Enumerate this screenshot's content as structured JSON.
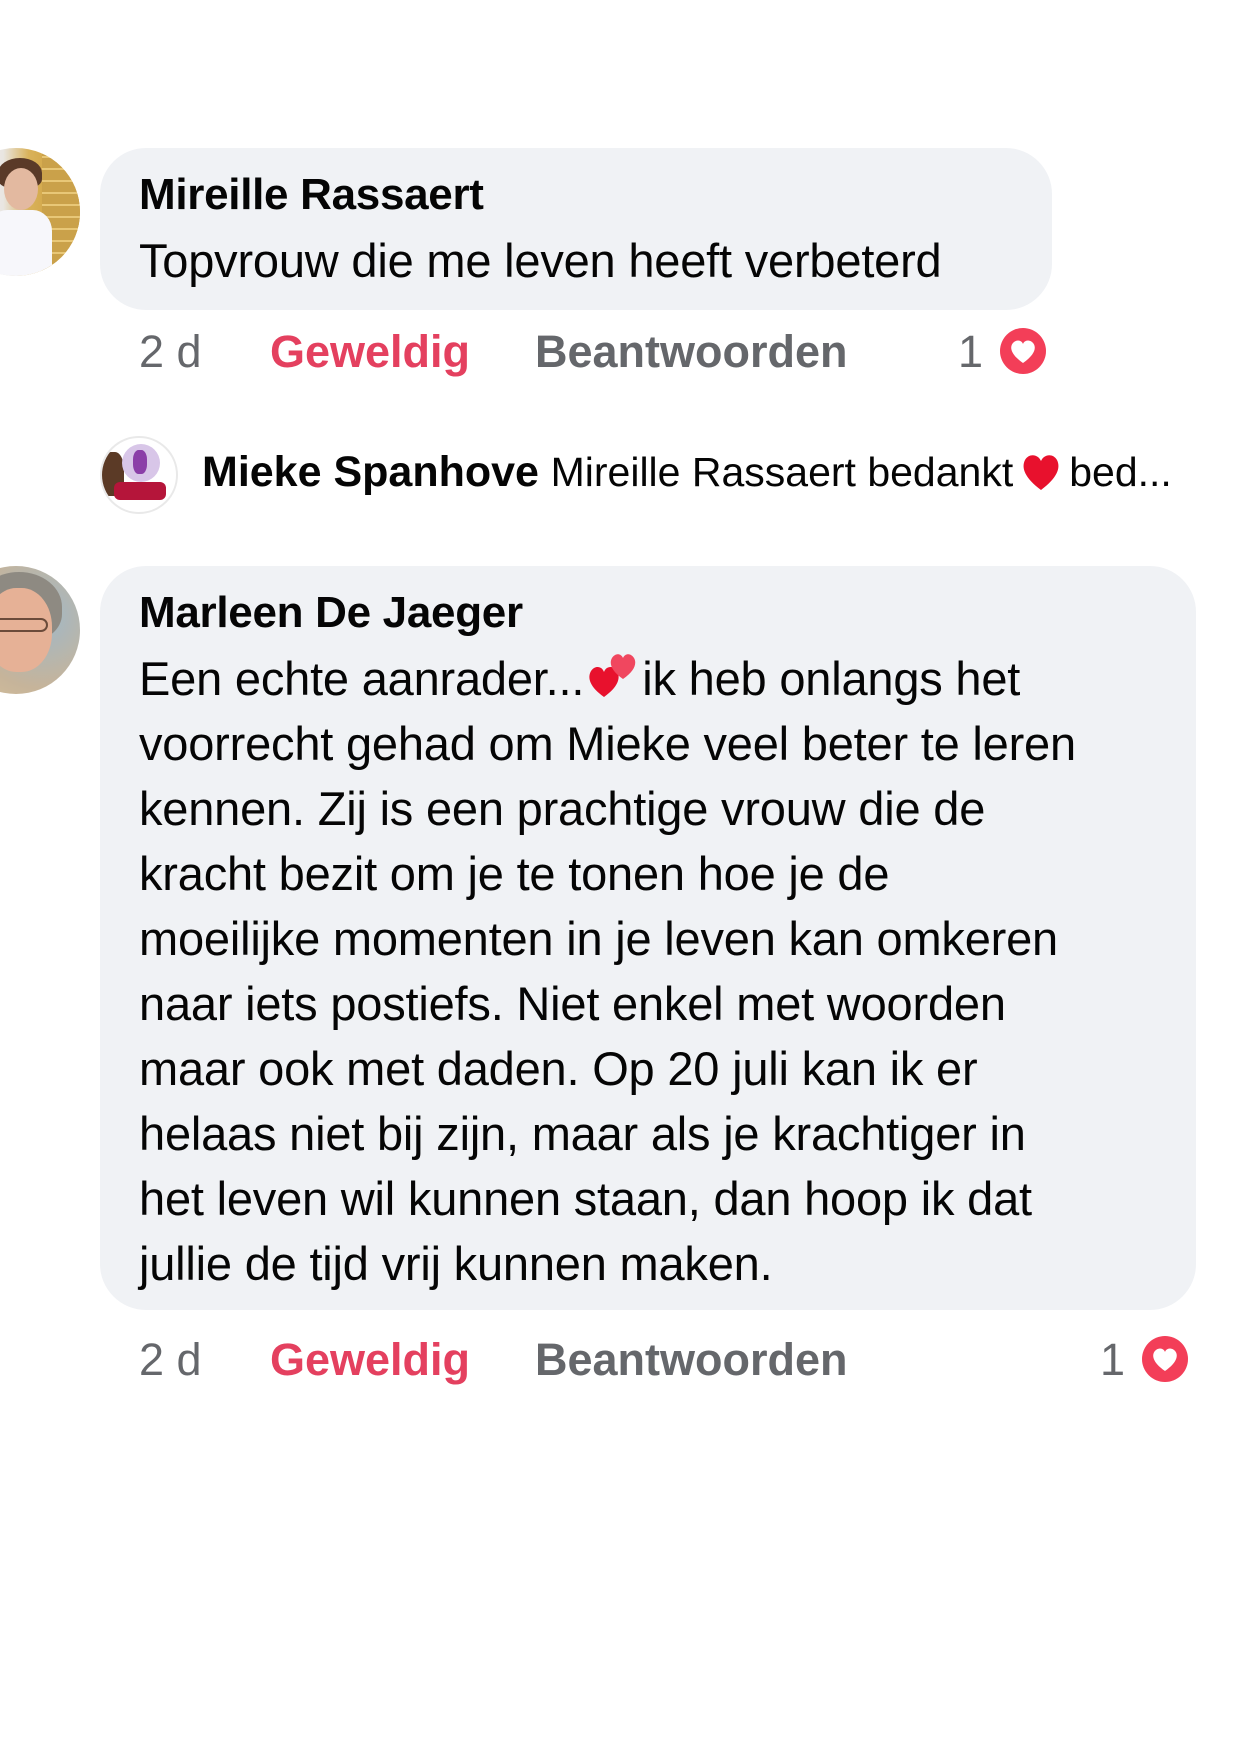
{
  "comments": [
    {
      "author": "Mireille Rassaert",
      "text": "Topvrouw die me leven heeft verbeterd",
      "time": "2 d",
      "like_label": "Geweldig",
      "reply_label": "Beantwoorden",
      "reaction_count": "1",
      "avatar": "profile-photo"
    },
    {
      "author": "Marleen De Jaeger",
      "text_lines": [
        "Een echte aanrader...",
        "ik heb onlangs het",
        "voorrecht gehad om Mieke veel beter te leren",
        "kennen. Zij is een prachtige vrouw die de",
        "kracht bezit om je te tonen hoe je de",
        "moeilijke momenten in je leven kan omkeren",
        "naar iets postiefs. Niet enkel met woorden",
        "maar ook met daden. Op 20 juli kan ik er",
        "helaas niet bij zijn, maar als je krachtiger in",
        "het leven wil kunnen staan, dan hoop ik dat",
        "jullie de tijd vrij kunnen maken."
      ],
      "time": "2 d",
      "like_label": "Geweldig",
      "reply_label": "Beantwoorden",
      "reaction_count": "1",
      "avatar": "profile-photo"
    }
  ],
  "reply_preview": {
    "author": "Mieke Spanhove",
    "text_before": "Mireille Rassaert bedankt",
    "text_after": "bed..."
  },
  "icons": {
    "reaction": "love-reaction-icon",
    "heart": "red-heart-emoji",
    "two_hearts": "two-hearts-emoji"
  },
  "colors": {
    "bubble": "#f0f2f5",
    "like_active": "#e4405f",
    "meta": "#65676b",
    "love": "#f33e58"
  }
}
